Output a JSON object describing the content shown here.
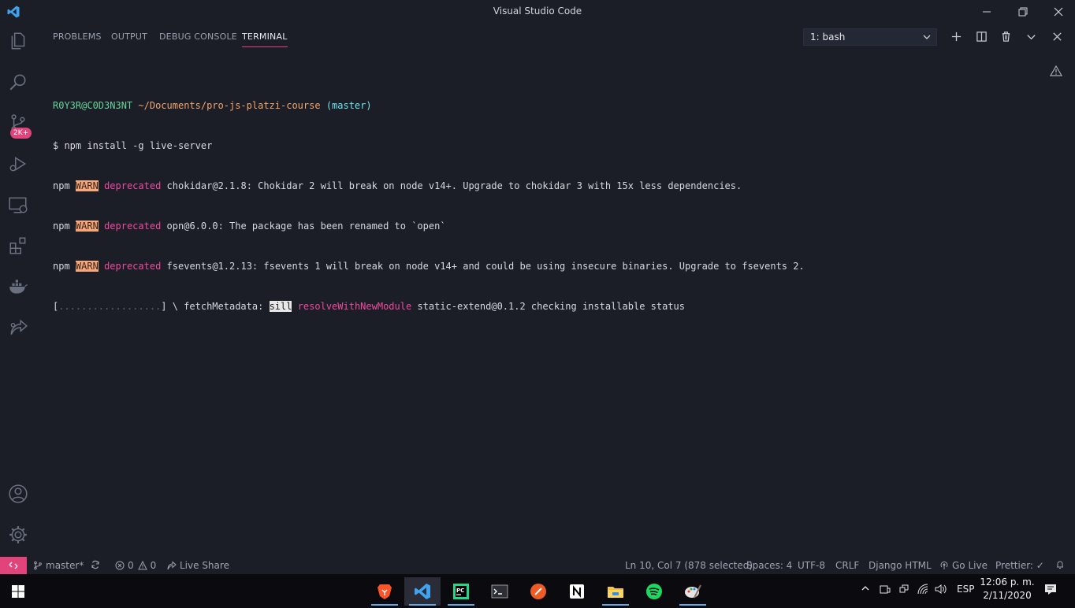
{
  "window": {
    "title": "Visual Studio Code"
  },
  "activity_bar": {
    "icons": [
      "explorer-icon",
      "search-icon",
      "source-control-icon",
      "run-debug-icon",
      "remote-explorer-icon",
      "extensions-icon",
      "docker-icon",
      "live-share-icon",
      "accounts-icon",
      "settings-gear-icon"
    ],
    "source_control_badge": "2K+"
  },
  "panel": {
    "tabs": [
      {
        "label": "PROBLEMS"
      },
      {
        "label": "OUTPUT"
      },
      {
        "label": "DEBUG CONSOLE"
      },
      {
        "label": "TERMINAL",
        "active": true
      }
    ],
    "terminal_selector": "1: bash",
    "accent": "#e0447b"
  },
  "terminal": {
    "prompt_user": "R0Y3R@C0D3N3NT",
    "prompt_path": "~/Documents/pro-js-platzi-course",
    "prompt_branch": "(master)",
    "command": "$ npm install -g live-server",
    "warn_lines": [
      {
        "prefix": "npm",
        "level": "WARN",
        "tag": "deprecated",
        "text": "chokidar@2.1.8: Chokidar 2 will break on node v14+. Upgrade to chokidar 3 with 15x less dependencies."
      },
      {
        "prefix": "npm",
        "level": "WARN",
        "tag": "deprecated",
        "text": "opn@6.0.0: The package has been renamed to `open`"
      },
      {
        "prefix": "npm",
        "level": "WARN",
        "tag": "deprecated",
        "text": "fsevents@1.2.13: fsevents 1 will break on node v14+ and could be using insecure binaries. Upgrade to fsevents 2."
      }
    ],
    "progress": {
      "bar_open": "[",
      "bar_dots": "..................",
      "bar_close": "] \\ fetchMetadata:",
      "sill": "sill",
      "module": "resolveWithNewModule",
      "status": "static-extend@0.1.2 checking installable status"
    }
  },
  "status_bar": {
    "branch": "master*",
    "errors": "0",
    "warnings": "0",
    "live_share": "Live Share",
    "cursor": "Ln 10, Col 7 (878 selected)",
    "spaces": "Spaces: 4",
    "encoding": "UTF-8",
    "eol": "CRLF",
    "language": "Django HTML",
    "go_live": "Go Live",
    "prettier": "Prettier: ✓"
  },
  "taskbar": {
    "apps": [
      "brave-icon",
      "vscode-icon",
      "pycharm-icon",
      "terminal-icon",
      "postman-icon",
      "notion-icon",
      "file-explorer-icon",
      "spotify-icon",
      "paint-icon"
    ],
    "language": "ESP",
    "time": "12:06 p. m.",
    "date": "2/11/2020"
  }
}
